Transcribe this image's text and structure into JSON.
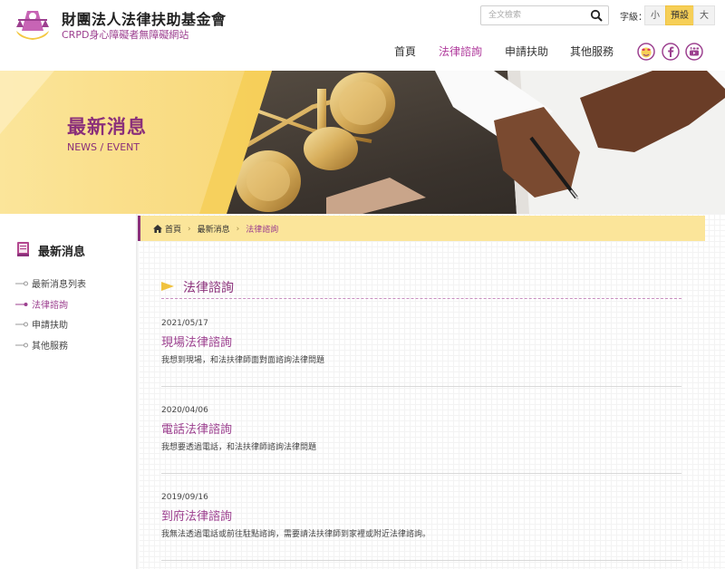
{
  "brand": {
    "title": "財團法人法律扶助基金會",
    "subtitle": "CRPD身心障礙者無障礙網站"
  },
  "search": {
    "placeholder": "全文檢索",
    "icon": "search-icon"
  },
  "font_size": {
    "label": "字級：",
    "options": [
      "小",
      "預設",
      "大"
    ],
    "selected": "預設"
  },
  "nav": {
    "items": [
      "首頁",
      "法律諮詢",
      "申請扶助",
      "其他服務"
    ],
    "active": "法律諮詢"
  },
  "social": {
    "icons": [
      "emoji-icon",
      "facebook-icon",
      "youtube-icon"
    ]
  },
  "banner": {
    "title": "最新消息",
    "subtitle": "NEWS / EVENT"
  },
  "sidebar": {
    "title": "最新消息",
    "items": [
      "最新消息列表",
      "法律諮詢",
      "申請扶助",
      "其他服務"
    ],
    "active": "法律諮詢"
  },
  "breadcrumb": {
    "home": "首頁",
    "items": [
      "最新消息",
      "法律諮詢"
    ]
  },
  "section": {
    "title": "法律諮詢"
  },
  "posts": [
    {
      "date": "2021/05/17",
      "title": "現場法律諮詢",
      "description": "我想到現場，和法扶律師面對面諮詢法律問題"
    },
    {
      "date": "2020/04/06",
      "title": "電話法律諮詢",
      "description": "我想要透過電話，和法扶律師諮詢法律問題"
    },
    {
      "date": "2019/09/16",
      "title": "到府法律諮詢",
      "description": "我無法透過電話或前往駐點諮詢，需要請法扶律師到家裡或附近法律諮詢。"
    }
  ],
  "colors": {
    "brand_purple": "#9c3f8f",
    "accent_yellow": "#fbe59a",
    "active_yellow": "#f6cf57"
  }
}
